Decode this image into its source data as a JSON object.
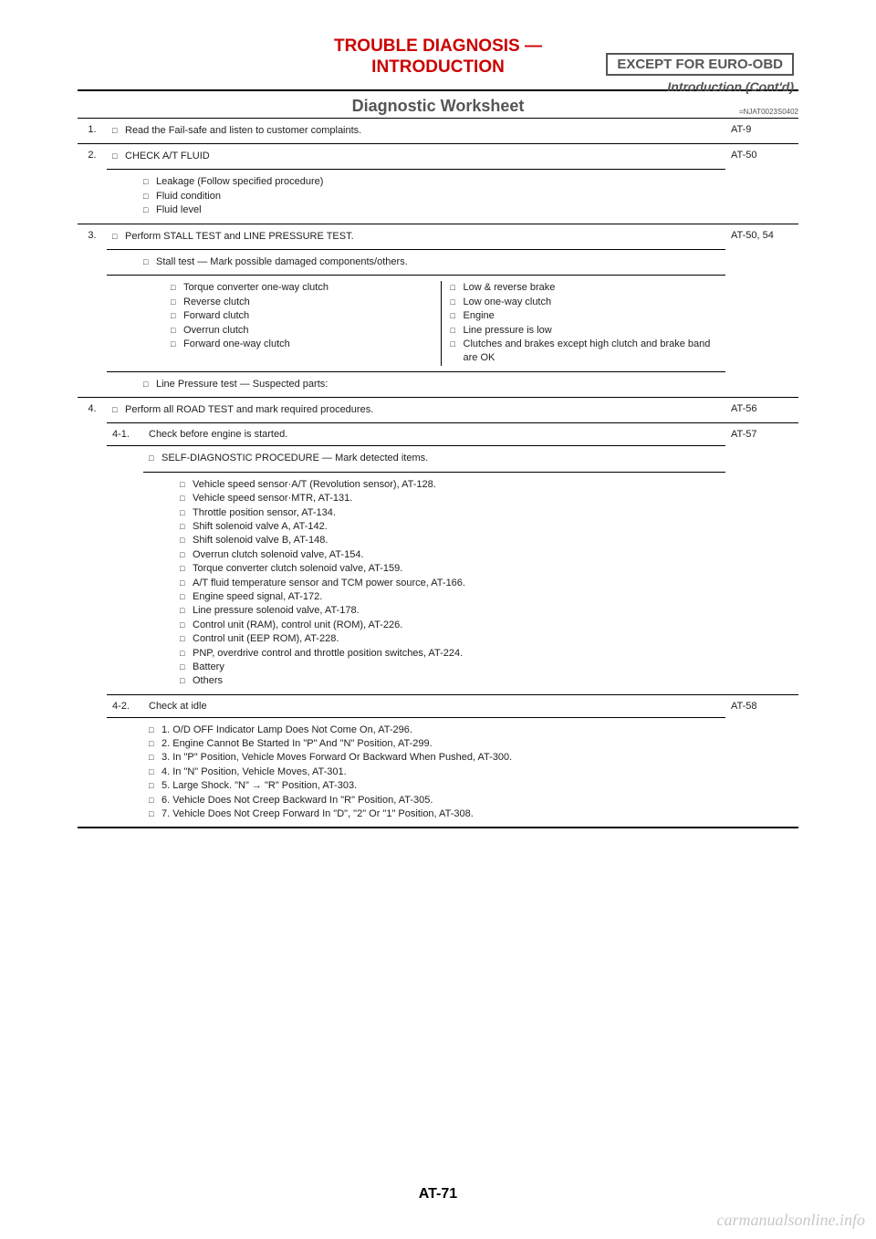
{
  "header": {
    "title_line1": "TROUBLE DIAGNOSIS —",
    "title_line2": "INTRODUCTION",
    "right_box": "EXCEPT FOR EURO-OBD",
    "right_sub": "Introduction (Cont'd)"
  },
  "section": {
    "title": "Diagnostic Worksheet",
    "code": "=NJAT0023S0402"
  },
  "rows": {
    "r1": {
      "num": "1.",
      "text": "Read the Fail-safe and listen to customer complaints.",
      "ref": "AT-9"
    },
    "r2": {
      "num": "2.",
      "text": "CHECK A/T FLUID",
      "ref": "AT-50",
      "sub": {
        "a": "Leakage (Follow specified procedure)",
        "b": "Fluid condition",
        "c": "Fluid level"
      }
    },
    "r3": {
      "num": "3.",
      "text": "Perform STALL TEST and LINE PRESSURE TEST.",
      "ref": "AT-50, 54",
      "sub1": "Stall test — Mark possible damaged components/others.",
      "left": {
        "a": "Torque converter one-way clutch",
        "b": "Reverse clutch",
        "c": "Forward clutch",
        "d": "Overrun clutch",
        "e": "Forward one-way clutch"
      },
      "right": {
        "a": "Low & reverse brake",
        "b": "Low one-way clutch",
        "c": "Engine",
        "d": "Line pressure is low",
        "e": "Clutches and brakes except high clutch and brake band are OK"
      },
      "sub2": "Line Pressure test — Suspected parts:"
    },
    "r4": {
      "num": "4.",
      "text": "Perform all ROAD TEST and mark required procedures.",
      "ref": "AT-56",
      "s41": {
        "num": "4-1.",
        "head": "Check before engine is started.",
        "ref": "AT-57",
        "sub": "SELF-DIAGNOSTIC PROCEDURE — Mark detected items.",
        "items": {
          "a": "Vehicle speed sensor·A/T (Revolution sensor), AT-128.",
          "b": "Vehicle speed sensor·MTR, AT-131.",
          "c": "Throttle position sensor, AT-134.",
          "d": "Shift solenoid valve A, AT-142.",
          "e": "Shift solenoid valve B, AT-148.",
          "f": "Overrun clutch solenoid valve, AT-154.",
          "g": "Torque converter clutch solenoid valve, AT-159.",
          "h": "A/T fluid temperature sensor and TCM power source, AT-166.",
          "i": "Engine speed signal, AT-172.",
          "j": "Line pressure solenoid valve, AT-178.",
          "k": "Control unit (RAM), control unit (ROM), AT-226.",
          "l": "Control unit (EEP ROM), AT-228.",
          "m": "PNP, overdrive control and throttle position switches, AT-224.",
          "n": "Battery",
          "o": "Others"
        }
      },
      "s42": {
        "num": "4-2.",
        "head": "Check at idle",
        "ref": "AT-58",
        "items": {
          "a": "1. O/D OFF Indicator Lamp Does Not Come On, AT-296.",
          "b": "2. Engine Cannot Be Started In \"P\" And \"N\" Position, AT-299.",
          "c": "3. In \"P\" Position, Vehicle Moves Forward Or Backward When Pushed, AT-300.",
          "d": "4. In \"N\" Position, Vehicle Moves, AT-301.",
          "e": "5. Large Shock. \"N\" → \"R\" Position, AT-303.",
          "f": "6. Vehicle Does Not Creep Backward In \"R\" Position, AT-305.",
          "g": "7. Vehicle Does Not Creep Forward In \"D\", \"2\" Or \"1\" Position, AT-308."
        }
      }
    }
  },
  "footer": {
    "pageno": "AT-71",
    "watermark": "carmanualsonline.info"
  }
}
